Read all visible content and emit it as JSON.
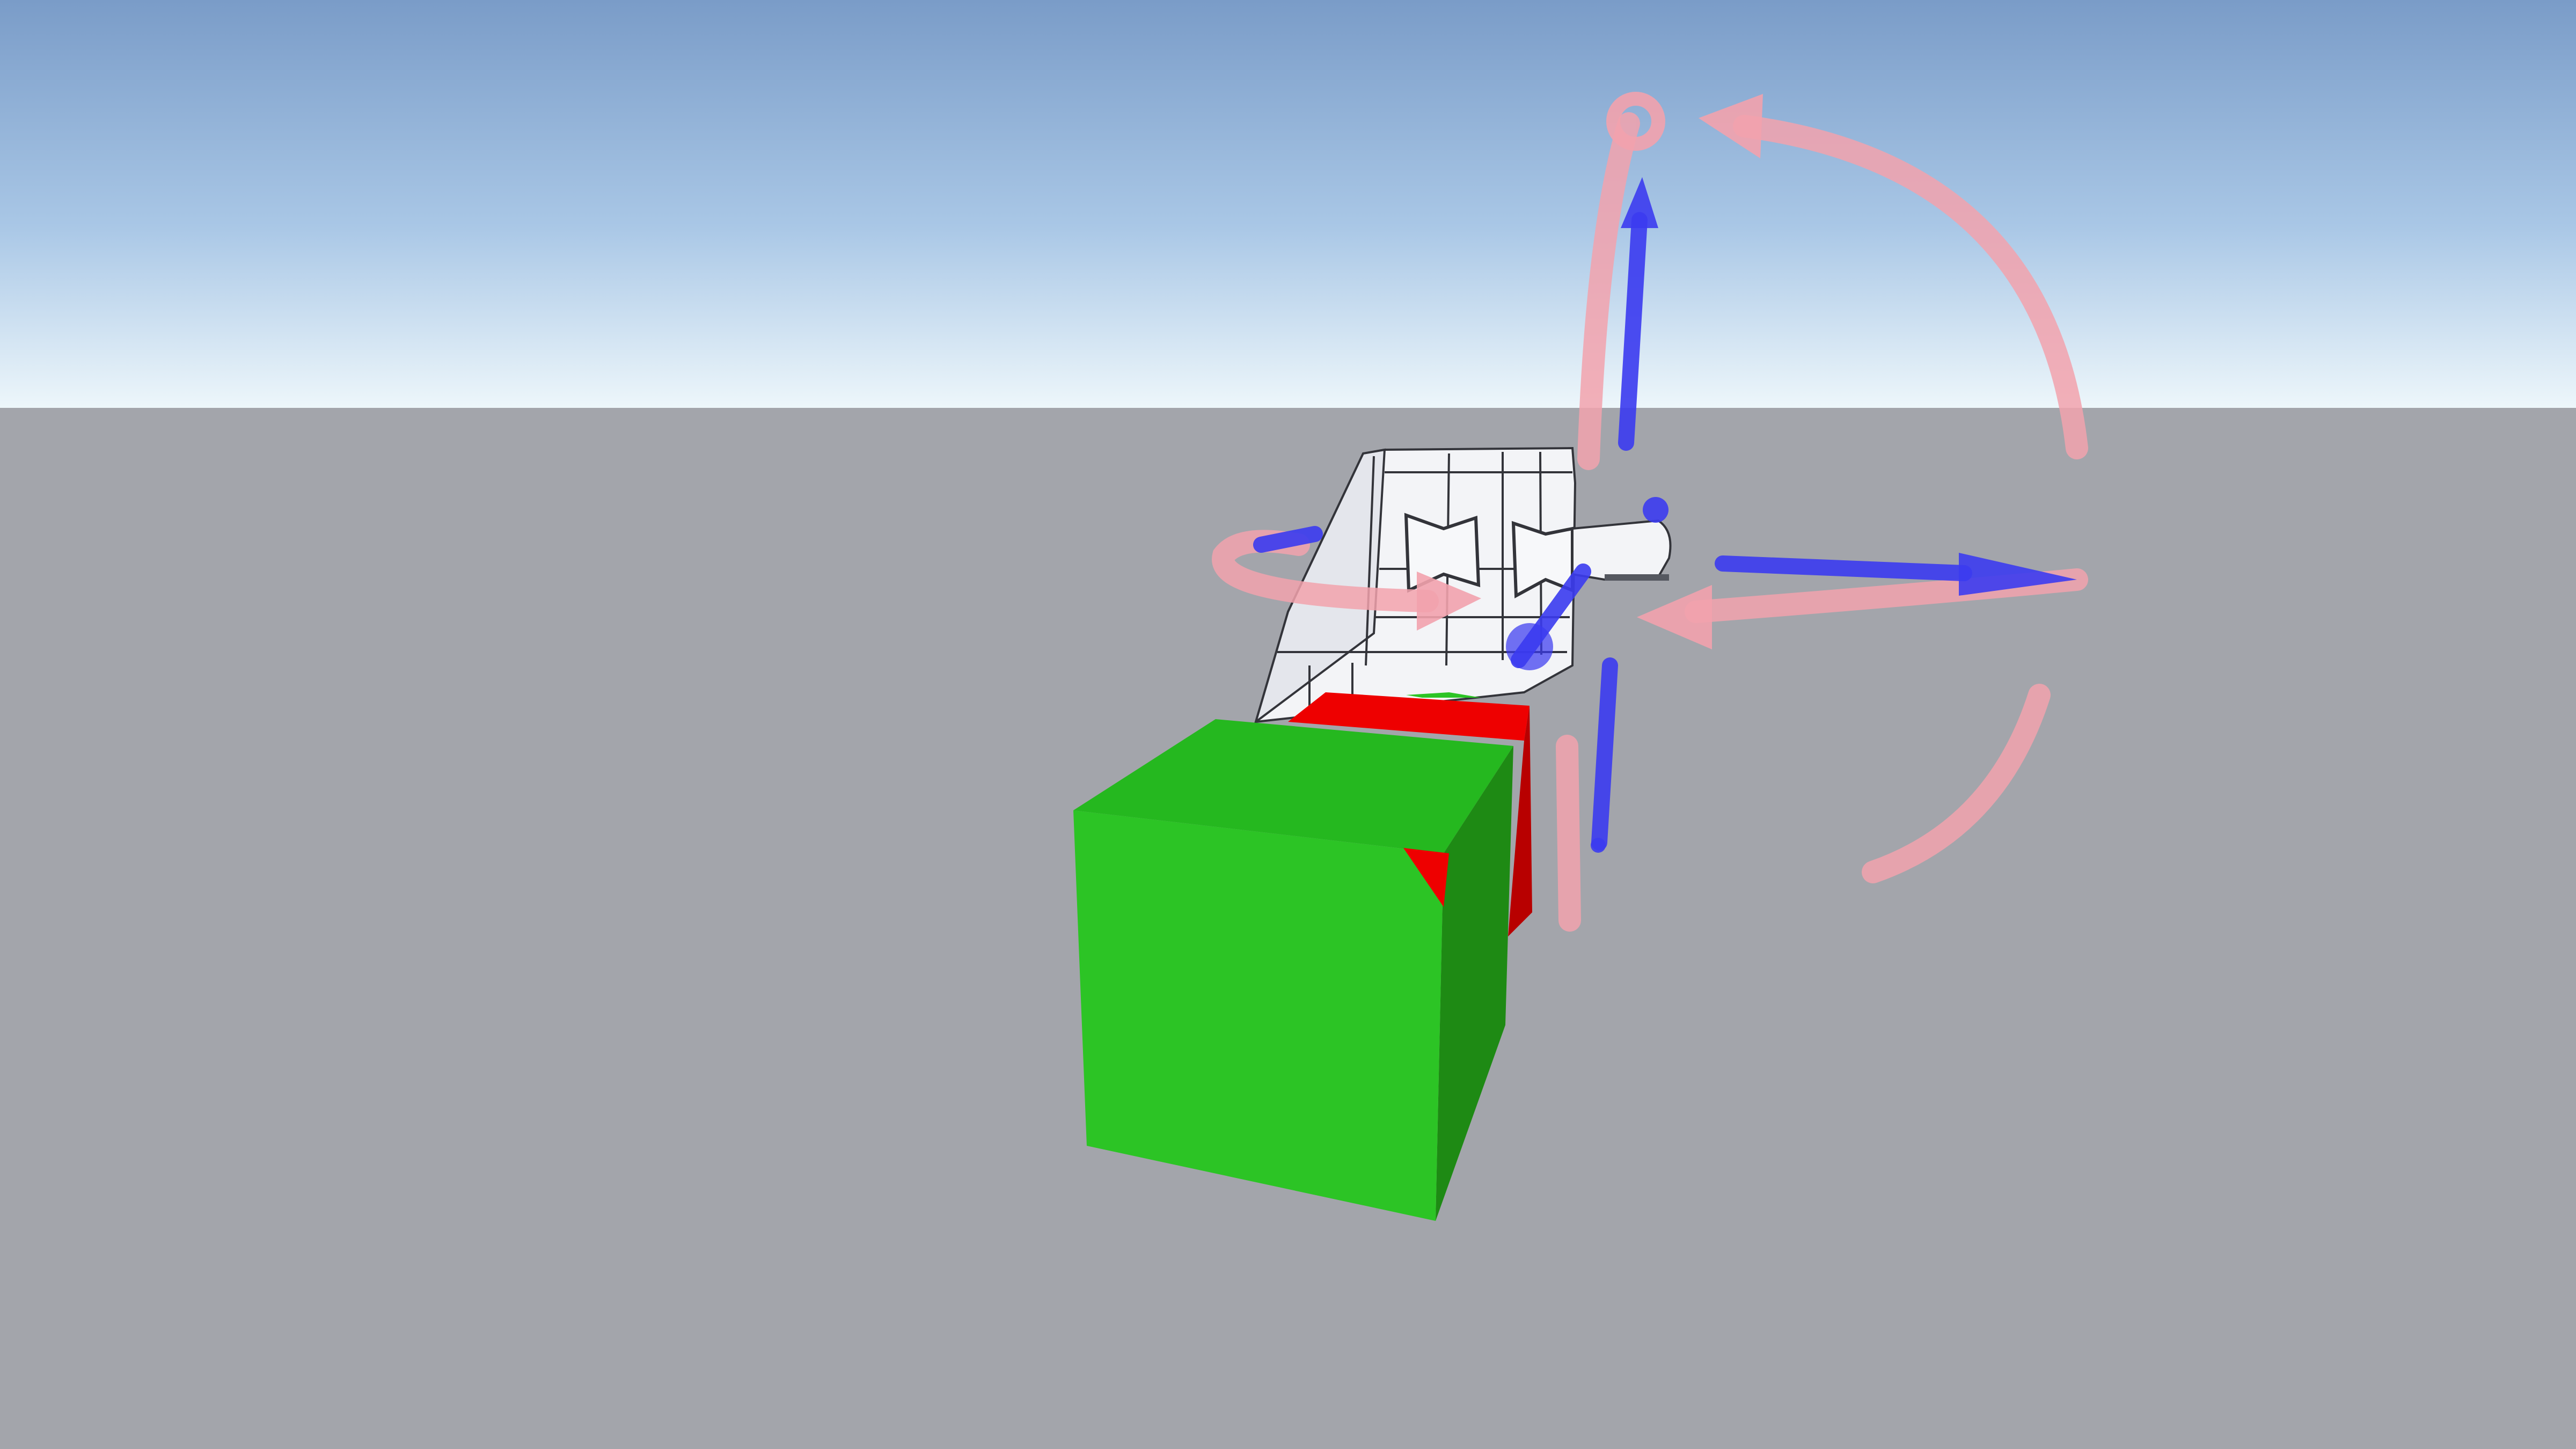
{
  "scene": {
    "colors": {
      "sky_top": "#7a9cc8",
      "sky_mid": "#a9c7e6",
      "sky_horizon": "#eef7fb",
      "ground": "#a3a5ab",
      "cube_green_front": "#2cc425",
      "cube_green_top": "#25b81f",
      "cube_green_side": "#1e8a14",
      "cube_red": "#ee0000",
      "cube_red_dark": "#b80000",
      "model_white": "#f3f4f7",
      "model_shade": "#d9dbe2",
      "model_edge": "#33343a",
      "gizmo_axis": "#3b3bf0",
      "gizmo_rotate": "#f2a2ad"
    },
    "objects": [
      "sky",
      "ground-plane",
      "white-model",
      "red-cube",
      "green-cube",
      "transform-gizmo"
    ]
  }
}
